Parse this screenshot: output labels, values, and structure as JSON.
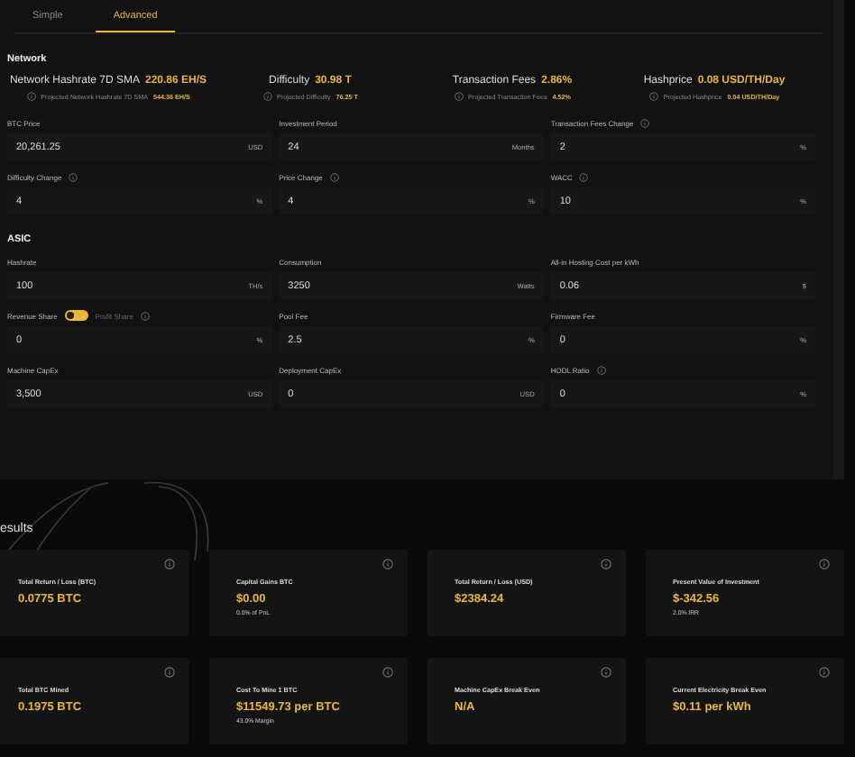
{
  "tabs": [
    {
      "label": "Simple",
      "selected": false
    },
    {
      "label": "Advanced",
      "selected": true
    }
  ],
  "network": {
    "title": "Network",
    "stats": [
      {
        "label": "Network Hashrate 7D SMA",
        "value": "220.86 EH/S",
        "projected_label": "Projected Network Hashrate 7D SMA",
        "projected_value": "544.36 EH/S"
      },
      {
        "label": "Difficulty",
        "value": "30.98 T",
        "projected_label": "Projected Difficulty",
        "projected_value": "76.25 T"
      },
      {
        "label": "Transaction Fees",
        "value": "2.86%",
        "projected_label": "Projected Transaction Fees",
        "projected_value": "4.52%"
      },
      {
        "label": "Hashprice",
        "value": "0.08 USD/TH/Day",
        "projected_label": "Projected Hashprice",
        "projected_value": "0.04 USD/TH/Day"
      }
    ],
    "fields": [
      {
        "kind": "field",
        "label": "BTC Price",
        "info": false,
        "value": "20,261.25",
        "unit": "USD"
      },
      {
        "kind": "field",
        "label": "Investment Period",
        "info": false,
        "value": "24",
        "unit": "Months"
      },
      {
        "kind": "field",
        "label": "Transaction Fees Change",
        "info": true,
        "value": "2",
        "unit": "%"
      },
      {
        "kind": "field",
        "label": "Difficulty Change",
        "info": true,
        "value": "4",
        "unit": "%"
      },
      {
        "kind": "field",
        "label": "Price Change",
        "info": true,
        "value": "4",
        "unit": "%"
      },
      {
        "kind": "field",
        "label": "WACC",
        "info": true,
        "value": "10",
        "unit": "%"
      }
    ]
  },
  "asic": {
    "title": "ASIC",
    "fields": [
      {
        "kind": "field",
        "label": "Hashrate",
        "info": false,
        "value": "100",
        "unit": "TH/s"
      },
      {
        "kind": "field",
        "label": "Consumption",
        "info": false,
        "value": "3250",
        "unit": "Watts"
      },
      {
        "kind": "field",
        "label": "All-in Hosting Cost per kWh",
        "info": false,
        "value": "0.06",
        "unit": "$"
      },
      {
        "kind": "toggle",
        "label": "Revenue Share",
        "other_label": "Profit Share",
        "on": false,
        "info": true,
        "value": "0",
        "unit": "%"
      },
      {
        "kind": "field",
        "label": "Pool Fee",
        "info": false,
        "value": "2.5",
        "unit": "%"
      },
      {
        "kind": "field",
        "label": "Firmware Fee",
        "info": false,
        "value": "0",
        "unit": "%"
      },
      {
        "kind": "field",
        "label": "Machine CapEx",
        "info": false,
        "value": "3,500",
        "unit": "USD"
      },
      {
        "kind": "field",
        "label": "Deployment CapEx",
        "info": false,
        "value": "0",
        "unit": "USD"
      },
      {
        "kind": "field",
        "label": "HODL Ratio",
        "info": true,
        "value": "0",
        "unit": "%"
      }
    ]
  },
  "results": {
    "title": "esults",
    "cards": [
      {
        "label": "Total Return / Loss (BTC)",
        "value": "0.0775 BTC"
      },
      {
        "label": "Capital Gains BTC",
        "value": "$0.00",
        "note": "0.0% of PnL"
      },
      {
        "label": "Total Return / Loss (USD)",
        "value": "$2384.24"
      },
      {
        "label": "Present Value of Investment",
        "value": "$-342.56",
        "note": "2.0% IRR"
      },
      {
        "label": "Total BTC Mined",
        "value": "0.1975 BTC"
      },
      {
        "label": "Cost To Mine 1 BTC",
        "value": "$11549.73 per BTC",
        "note": "43.0% Margin"
      },
      {
        "label": "Machine CapEx Break Even",
        "value": "N/A"
      },
      {
        "label": "Current Electricity Break Even",
        "value": "$0.11 per kWh"
      }
    ]
  }
}
